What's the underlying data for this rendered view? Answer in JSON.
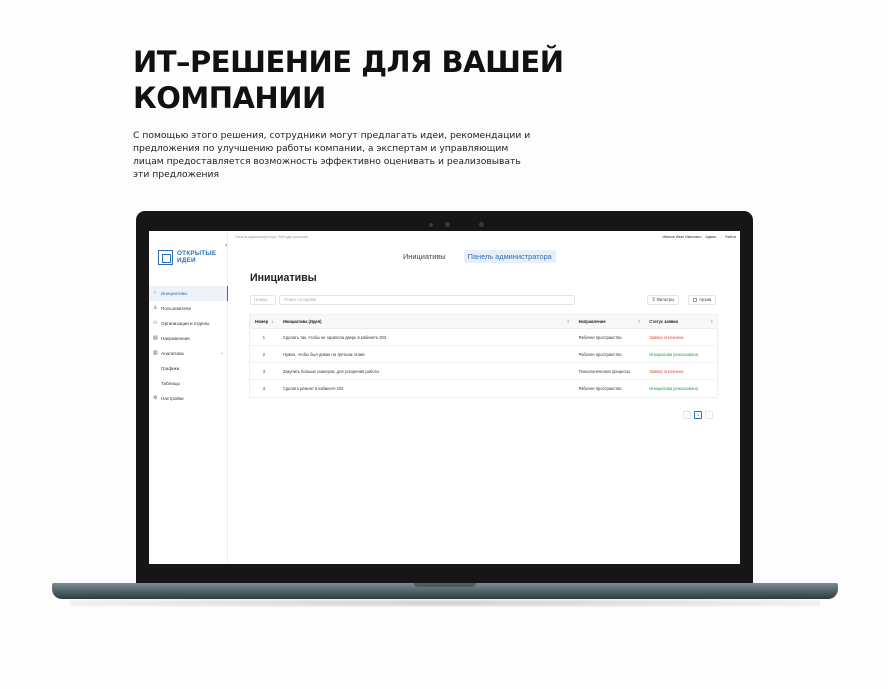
{
  "hero": {
    "title": "ИТ–РЕШЕНИЕ ДЛЯ ВАШЕЙ КОМПАНИИ",
    "description": "С помощью этого решения, сотрудники могут предлагать идеи, рекомендации и предложения по улучшению работы компании, а экспертам и управляющим лицам предоставляется возможность эффективно оценивать и реализовывать эти предложения"
  },
  "app": {
    "logo": {
      "line1": "ОТКРЫТЫЕ",
      "line2": "ИДЕИ"
    },
    "collapse_glyph": "‹",
    "breadcrumb": "Панель администратора  /  Методы решения",
    "user": {
      "name": "Иванов Иван Иванович",
      "role": "Админ",
      "sep": "|",
      "logout": "Выйти"
    },
    "sidebar": {
      "items": [
        {
          "label": "Инициативы",
          "icon": "lightbulb-icon",
          "glyph": "♀",
          "active": true
        },
        {
          "label": "Пользователи",
          "icon": "user-icon",
          "glyph": "♙",
          "active": false
        },
        {
          "label": "Организации и отделы",
          "icon": "org-icon",
          "glyph": "⚇",
          "active": false
        },
        {
          "label": "Направления",
          "icon": "folder-icon",
          "glyph": "▤",
          "active": false
        },
        {
          "label": "Аналитика",
          "icon": "chart-icon",
          "glyph": "▥",
          "active": false,
          "caret": "^"
        },
        {
          "label": "Графики",
          "icon": "",
          "glyph": "",
          "active": false,
          "sub": true
        },
        {
          "label": "Таблицы",
          "icon": "",
          "glyph": "",
          "active": false,
          "sub": true
        },
        {
          "label": "Настройки",
          "icon": "gear-icon",
          "glyph": "⚙",
          "active": false
        }
      ]
    },
    "tabs": [
      {
        "label": "Инициативы",
        "active": false
      },
      {
        "label": "Панель администратора",
        "active": true
      }
    ],
    "page_title": "Инициативы",
    "filters": {
      "number_placeholder": "Номер",
      "search_placeholder": "Поиск по идеям",
      "filter_label": "Фильтры",
      "filter_glyph": "⊽",
      "archive_label": "Архив"
    },
    "table": {
      "columns": [
        "Номер",
        "Инициатива (Идея)",
        "Направление",
        "Статус заявки"
      ],
      "sort_glyph": "⇕",
      "filter_glyph": "⊽",
      "rows": [
        {
          "num": "1",
          "idea": "Сделать так, чтобы не скрипела дверь в кабинете 203",
          "direction": "Рабочее пространство",
          "status": "Заявка отклонена",
          "status_color": "#e0443a"
        },
        {
          "num": "2",
          "idea": "Нужно, чтобы был диван на третьем этаже",
          "direction": "Рабочее пространство",
          "status": "Инициатива реализована",
          "status_color": "#2aa148"
        },
        {
          "num": "3",
          "idea": "Закупить больше сканеров, для ускорения работы",
          "direction": "Технологические процессы",
          "status": "Заявка отклонена",
          "status_color": "#e0443a"
        },
        {
          "num": "4",
          "idea": "Сделать ремонт в кабинете 102",
          "direction": "Рабочее пространство",
          "status": "Инициатива реализована",
          "status_color": "#2aa148"
        }
      ]
    },
    "pagination": {
      "prev": "‹",
      "current": "1",
      "next": "›"
    }
  },
  "colors": {
    "accent": "#2f6fb0",
    "rejected": "#e0443a",
    "implemented": "#2aa148"
  }
}
